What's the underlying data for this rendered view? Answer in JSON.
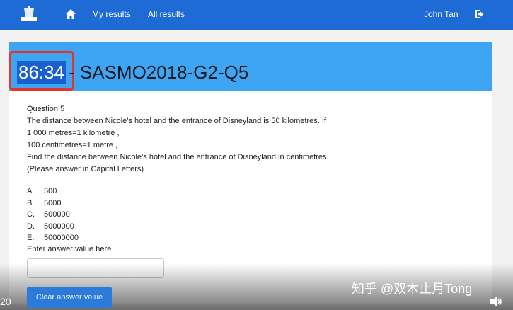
{
  "navbar": {
    "logo_icon": "app-logo-icon",
    "home_icon": "home-icon",
    "my_results": "My results",
    "all_results": "All results",
    "user_name": "John Tan",
    "logout_icon": "logout-icon",
    "color": "#1f6bd6"
  },
  "header": {
    "timer": "86:34",
    "title": " - SASMO2018-G2-Q5",
    "color": "#3ea5f5"
  },
  "question": {
    "number": "Question 5",
    "lines": [
      "The distance between Nicole’s hotel and the entrance of Disneyland is 50 kilometres. If",
      "1 000 metres=1 kilometre ,",
      "100 centimetres=1 metre ,",
      "Find the distance between Nicole’s hotel and the entrance of Disneyland in centimetres.",
      "(Please answer in Capital Letters)"
    ]
  },
  "options": [
    {
      "letter": "A.",
      "value": "500"
    },
    {
      "letter": "B.",
      "value": "5000"
    },
    {
      "letter": "C.",
      "value": "500000"
    },
    {
      "letter": "D.",
      "value": "5000000"
    },
    {
      "letter": "E.",
      "value": "50000000"
    }
  ],
  "answer": {
    "label": "Enter answer value here",
    "value": "",
    "clear_label": "Clear answer value"
  },
  "video_overlay": {
    "watermark": "知乎 @双木止月Tong",
    "time_left": "20",
    "volume_icon": "volume-icon"
  }
}
